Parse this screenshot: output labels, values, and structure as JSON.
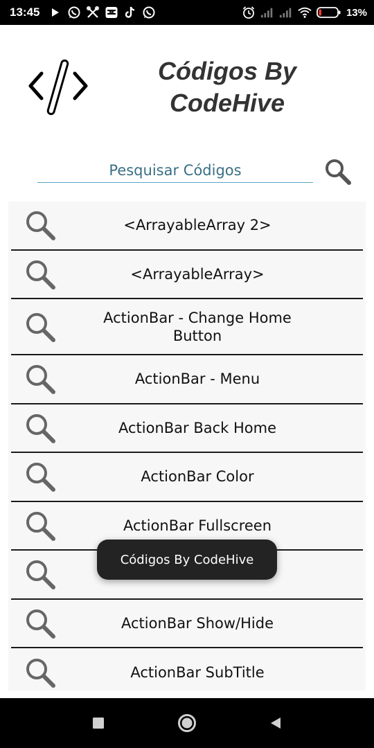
{
  "status_bar": {
    "time": "13:45",
    "battery_percent": "13%",
    "battery_color": "#ff3b30",
    "left_icons": [
      "play-icon",
      "whatsapp-icon",
      "tools-icon",
      "message-icon",
      "tiktok-icon",
      "whatsapp-icon"
    ],
    "right_icons": [
      "alarm-icon",
      "signal-icon",
      "signal-icon",
      "wifi-icon",
      "battery-icon"
    ]
  },
  "header": {
    "logo_icon": "code-brackets-icon",
    "title_line1": "Códigos By",
    "title_line2": "CodeHive"
  },
  "search": {
    "placeholder": "Pesquisar Códigos",
    "value": "",
    "accent_color": "#5aa5c8",
    "button_icon": "search-icon"
  },
  "list": {
    "item_icon": "search-icon",
    "items": [
      {
        "label": "<ArrayableArray 2>"
      },
      {
        "label": "<ArrayableArray>"
      },
      {
        "label": "ActionBar - Change Home Button"
      },
      {
        "label": "ActionBar - Menu"
      },
      {
        "label": "ActionBar Back Home"
      },
      {
        "label": "ActionBar Color"
      },
      {
        "label": "ActionBar Fullscreen"
      },
      {
        "label": ""
      },
      {
        "label": "ActionBar Show/Hide"
      },
      {
        "label": "ActionBar SubTitle"
      }
    ]
  },
  "toast": {
    "text": "Códigos By CodeHive"
  },
  "nav_bar": {
    "buttons": [
      "recents-square-icon",
      "home-circle-icon",
      "back-triangle-icon"
    ]
  }
}
